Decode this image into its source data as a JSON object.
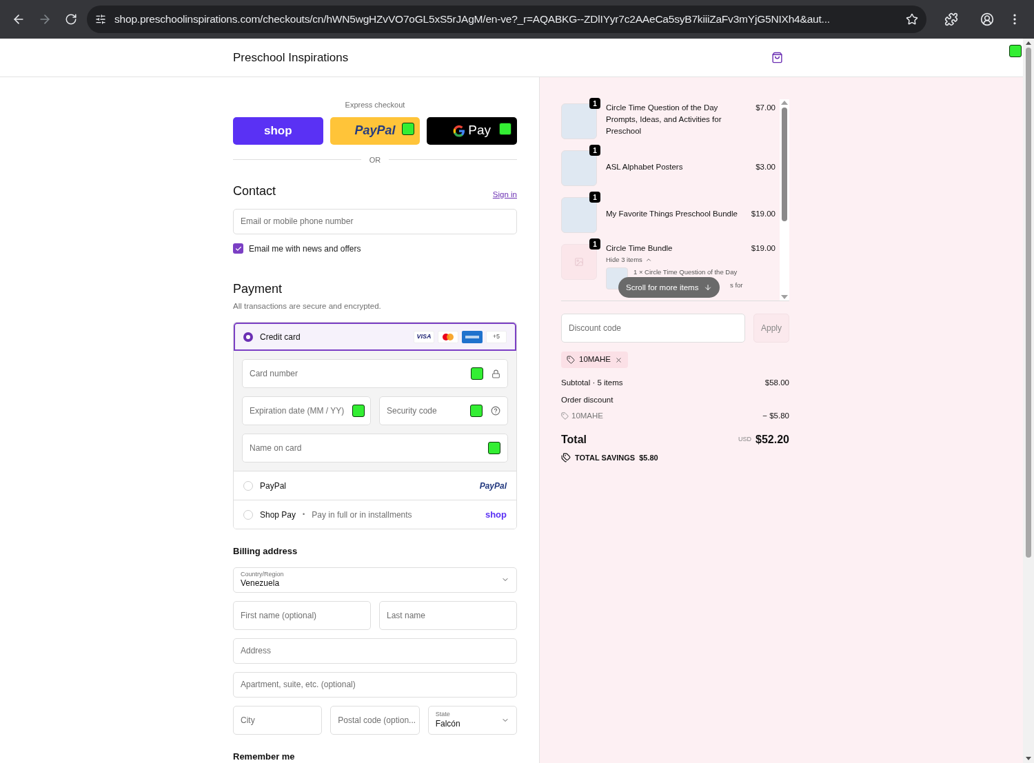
{
  "browser": {
    "url": "shop.preschoolinspirations.com/checkouts/cn/hWN5wgHZvVO7oGL5xS5rJAgM/en-ve?_r=AQABKG--ZDlIYyr7c2AAeCa5syB7kiiiZaFv3mYjG5NIXh4&aut..."
  },
  "header": {
    "store_name": "Preschool Inspirations",
    "marker": true
  },
  "express": {
    "title": "Express checkout",
    "divider": "OR",
    "buttons": [
      {
        "kind": "shop",
        "label": "shop",
        "marker": false
      },
      {
        "kind": "paypal",
        "label": "PayPal",
        "marker": true
      },
      {
        "kind": "gpay",
        "label": "Pay",
        "marker": true
      }
    ]
  },
  "contact": {
    "title": "Contact",
    "sign_in": "Sign in",
    "email_placeholder": "Email or mobile phone number",
    "newsletter": {
      "label": "Email me with news and offers",
      "checked": true
    }
  },
  "payment": {
    "title": "Payment",
    "subtitle": "All transactions are secure and encrypted.",
    "methods": [
      {
        "kind": "card",
        "label": "Credit card",
        "selected": true,
        "badges": [
          "VISA",
          "+5"
        ],
        "fields": [
          {
            "kind": "number",
            "placeholder": "Card number",
            "marker": true
          },
          {
            "kind": "expiry",
            "placeholder": "Expiration date (MM / YY)",
            "marker": true
          },
          {
            "kind": "cvv",
            "placeholder": "Security code",
            "marker": true
          },
          {
            "kind": "name",
            "placeholder": "Name on card",
            "marker": true
          }
        ]
      },
      {
        "kind": "paypal",
        "label": "PayPal",
        "selected": false,
        "logo": "PayPal"
      },
      {
        "kind": "shoppay",
        "label": "Shop Pay",
        "separator": "•",
        "note": "Pay in full or in installments",
        "selected": false,
        "logo": "shop"
      }
    ]
  },
  "billing": {
    "title": "Billing address",
    "country": {
      "label": "Country/Region",
      "value": "Venezuela"
    },
    "first_name": "First name (optional)",
    "last_name": "Last name",
    "address": "Address",
    "apartment": "Apartment, suite, etc. (optional)",
    "city": "City",
    "postal": "Postal code (option...",
    "state": {
      "label": "State",
      "value": "Falcón"
    }
  },
  "remember": {
    "title": "Remember me"
  },
  "summary": {
    "items": [
      {
        "name": "Circle Time Question of the Day Prompts, Ideas, and Activities for Preschool",
        "price": "$7.00",
        "qty": "1",
        "has_image": true
      },
      {
        "name": "ASL Alphabet Posters",
        "price": "$3.00",
        "qty": "1",
        "has_image": true
      },
      {
        "name": "My Favorite Things Preschool Bundle",
        "price": "$19.00",
        "qty": "1",
        "has_image": true
      },
      {
        "name": "Circle Time Bundle",
        "price": "$19.00",
        "qty": "1",
        "has_image": false,
        "toggle": "Hide 3 items",
        "expanded": true,
        "sub_item": "1 × Circle Time Question of the Day",
        "sub_item_tail": "s for"
      }
    ],
    "scroll_hint": "Scroll for more items",
    "discount_placeholder": "Discount code",
    "apply": "Apply",
    "applied_code": "10MAHE",
    "subtotal_label": "Subtotal · 5 items",
    "subtotal": "$58.00",
    "discount_label": "Order discount",
    "discount_code": "10MAHE",
    "discount_amount": "− $5.80",
    "total_label": "Total",
    "currency": "USD",
    "total": "$52.20",
    "savings_label": "TOTAL SAVINGS",
    "savings": "$5.80"
  }
}
